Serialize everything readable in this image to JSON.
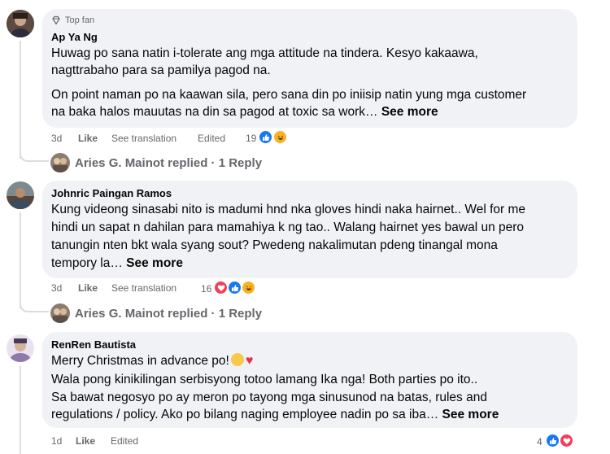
{
  "comments": [
    {
      "author": "Ap Ya Ng",
      "badge": "Top fan",
      "lines": [
        "Huwag po sana natin i-tolerate ang mga attitude na tindera. Kesyo kakaawa,",
        "nagttrabaho para sa pamilya pagod na.",
        "On point naman po na kaawan sila, pero sana din po iniisip natin yung mga customer",
        "na baka halos mauutas na din sa pagod at toxic sa work… "
      ],
      "see_more": "See more",
      "time": "3d",
      "like": "Like",
      "translate": "See translation",
      "edited": "Edited",
      "reaction_count": "19",
      "reply_name": "Aries G. Mainot replied",
      "reply_count": " · 1 Reply"
    },
    {
      "author": "Johnric Paingan Ramos",
      "lines": [
        "Kung videong sinasabi nito is madumi hnd nka gloves hindi naka hairnet.. Wel for me",
        "hindi un sapat n dahilan para mamahiya k ng tao.. Walang hairnet yes bawal un pero",
        "tanungin nten bkt wala syang sout? Pwedeng nakalimutan pdeng tinangal mona",
        "tempory la… "
      ],
      "see_more": "See more",
      "time": "3d",
      "like": "Like",
      "translate": "See translation",
      "reaction_count": "16",
      "reply_name": "Aries G. Mainot replied",
      "reply_count": " · 1 Reply"
    },
    {
      "author": "RenRen Bautista",
      "lines": [
        "Merry Christmas in advance po!",
        "Wala pong kinikilingan serbisyong totoo lamang Ika nga! Both parties po ito..",
        "Sa bawat negosyo po ay meron po tayong mga sinusunod na batas, rules and",
        "regulations / policy. Ako po bilang naging employee nadin po sa iba… "
      ],
      "see_more": "See more",
      "time": "1d",
      "like": "Like",
      "edited": "Edited",
      "reaction_count": "4"
    }
  ]
}
